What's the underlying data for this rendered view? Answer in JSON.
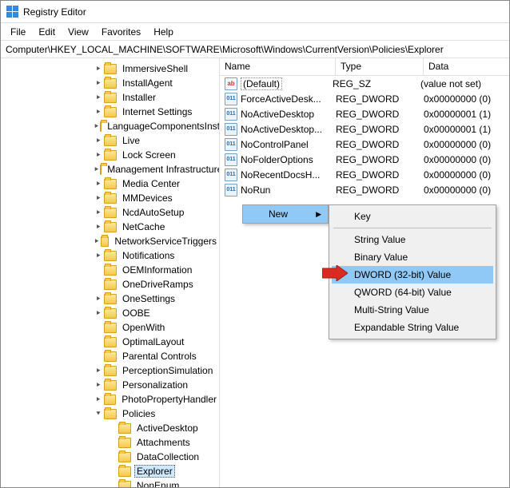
{
  "window": {
    "title": "Registry Editor"
  },
  "menu": {
    "file": "File",
    "edit": "Edit",
    "view": "View",
    "favorites": "Favorites",
    "help": "Help"
  },
  "address": "Computer\\HKEY_LOCAL_MACHINE\\SOFTWARE\\Microsoft\\Windows\\CurrentVersion\\Policies\\Explorer",
  "cols": {
    "name": "Name",
    "type": "Type",
    "data": "Data"
  },
  "tree": [
    {
      "label": "ImmersiveShell",
      "indent": 116,
      "exp": "right"
    },
    {
      "label": "InstallAgent",
      "indent": 116,
      "exp": "right"
    },
    {
      "label": "Installer",
      "indent": 116,
      "exp": "right"
    },
    {
      "label": "Internet Settings",
      "indent": 116,
      "exp": "right"
    },
    {
      "label": "LanguageComponentsInstaller",
      "indent": 116,
      "exp": "right"
    },
    {
      "label": "Live",
      "indent": 116,
      "exp": "right"
    },
    {
      "label": "Lock Screen",
      "indent": 116,
      "exp": "right"
    },
    {
      "label": "Management Infrastructure",
      "indent": 116,
      "exp": "right"
    },
    {
      "label": "Media Center",
      "indent": 116,
      "exp": "right"
    },
    {
      "label": "MMDevices",
      "indent": 116,
      "exp": "right"
    },
    {
      "label": "NcdAutoSetup",
      "indent": 116,
      "exp": "right"
    },
    {
      "label": "NetCache",
      "indent": 116,
      "exp": "right"
    },
    {
      "label": "NetworkServiceTriggers",
      "indent": 116,
      "exp": "right"
    },
    {
      "label": "Notifications",
      "indent": 116,
      "exp": "right"
    },
    {
      "label": "OEMInformation",
      "indent": 116,
      "exp": ""
    },
    {
      "label": "OneDriveRamps",
      "indent": 116,
      "exp": ""
    },
    {
      "label": "OneSettings",
      "indent": 116,
      "exp": "right"
    },
    {
      "label": "OOBE",
      "indent": 116,
      "exp": "right"
    },
    {
      "label": "OpenWith",
      "indent": 116,
      "exp": ""
    },
    {
      "label": "OptimalLayout",
      "indent": 116,
      "exp": ""
    },
    {
      "label": "Parental Controls",
      "indent": 116,
      "exp": ""
    },
    {
      "label": "PerceptionSimulation",
      "indent": 116,
      "exp": "right"
    },
    {
      "label": "Personalization",
      "indent": 116,
      "exp": "right"
    },
    {
      "label": "PhotoPropertyHandler",
      "indent": 116,
      "exp": "right"
    },
    {
      "label": "Policies",
      "indent": 116,
      "exp": "down",
      "sel": false
    },
    {
      "label": "ActiveDesktop",
      "indent": 134,
      "exp": ""
    },
    {
      "label": "Attachments",
      "indent": 134,
      "exp": ""
    },
    {
      "label": "DataCollection",
      "indent": 134,
      "exp": ""
    },
    {
      "label": "Explorer",
      "indent": 134,
      "exp": "",
      "sel": true
    },
    {
      "label": "NonEnum",
      "indent": 134,
      "exp": ""
    }
  ],
  "values": [
    {
      "icon": "str",
      "name": "(Default)",
      "def": true,
      "type": "REG_SZ",
      "data": "(value not set)"
    },
    {
      "icon": "dw",
      "name": "ForceActiveDesk...",
      "type": "REG_DWORD",
      "data": "0x00000000 (0)"
    },
    {
      "icon": "dw",
      "name": "NoActiveDesktop",
      "type": "REG_DWORD",
      "data": "0x00000001 (1)"
    },
    {
      "icon": "dw",
      "name": "NoActiveDesktop...",
      "type": "REG_DWORD",
      "data": "0x00000001 (1)"
    },
    {
      "icon": "dw",
      "name": "NoControlPanel",
      "type": "REG_DWORD",
      "data": "0x00000000 (0)"
    },
    {
      "icon": "dw",
      "name": "NoFolderOptions",
      "type": "REG_DWORD",
      "data": "0x00000000 (0)"
    },
    {
      "icon": "dw",
      "name": "NoRecentDocsH...",
      "type": "REG_DWORD",
      "data": "0x00000000 (0)"
    },
    {
      "icon": "dw",
      "name": "NoRun",
      "type": "REG_DWORD",
      "data": "0x00000000 (0)"
    }
  ],
  "ctx": {
    "new_label": "New",
    "items": [
      {
        "label": "Key",
        "sep_after": true
      },
      {
        "label": "String Value"
      },
      {
        "label": "Binary Value"
      },
      {
        "label": "DWORD (32-bit) Value",
        "hl": true
      },
      {
        "label": "QWORD (64-bit) Value"
      },
      {
        "label": "Multi-String Value"
      },
      {
        "label": "Expandable String Value"
      }
    ]
  }
}
